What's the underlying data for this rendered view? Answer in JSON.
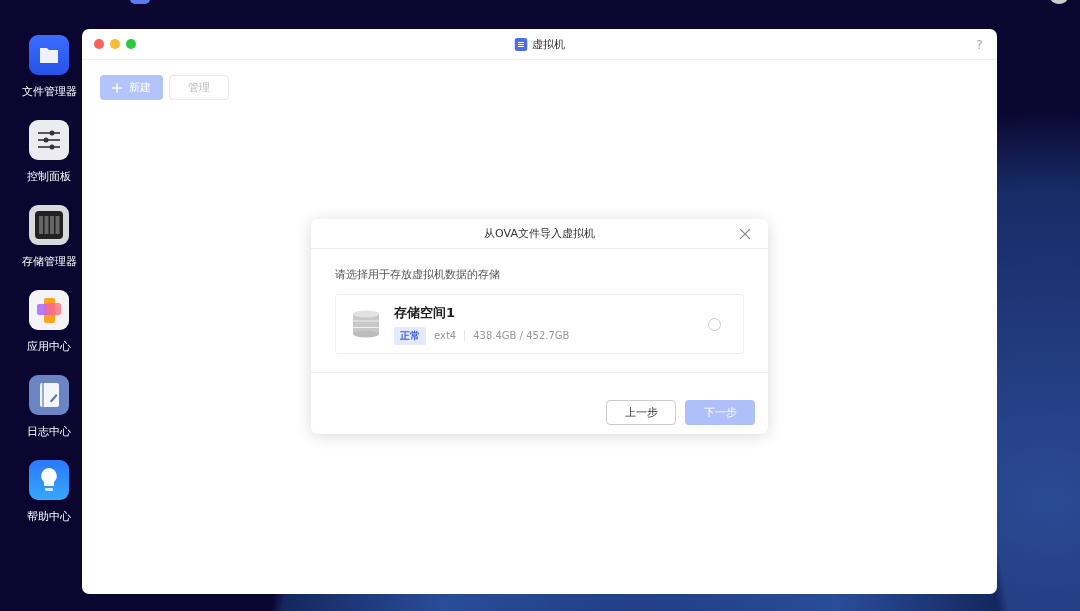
{
  "desktop_icons": [
    {
      "label": "文件管理器",
      "kind": "files"
    },
    {
      "label": "控制面板",
      "kind": "control"
    },
    {
      "label": "存储管理器",
      "kind": "storage"
    },
    {
      "label": "应用中心",
      "kind": "apps"
    },
    {
      "label": "日志中心",
      "kind": "log"
    },
    {
      "label": "帮助中心",
      "kind": "help"
    }
  ],
  "window": {
    "title": "虚拟机",
    "help": "?",
    "toolbar": [
      {
        "label": "新建",
        "kind": "primary",
        "disabled": true
      },
      {
        "label": "管理",
        "kind": "secondary",
        "disabled": true
      }
    ]
  },
  "dialog": {
    "title": "从OVA文件导入虚拟机",
    "prompt": "请选择用于存放虚拟机数据的存储",
    "storages": [
      {
        "name": "存储空间1",
        "status": "正常",
        "filesystem": "ext4",
        "usage": "438.4GB / 452.7GB",
        "selected": false
      }
    ],
    "buttons": [
      {
        "label": "上一步",
        "kind": "secondary",
        "disabled": false
      },
      {
        "label": "下一步",
        "kind": "primary",
        "disabled": true
      }
    ]
  }
}
